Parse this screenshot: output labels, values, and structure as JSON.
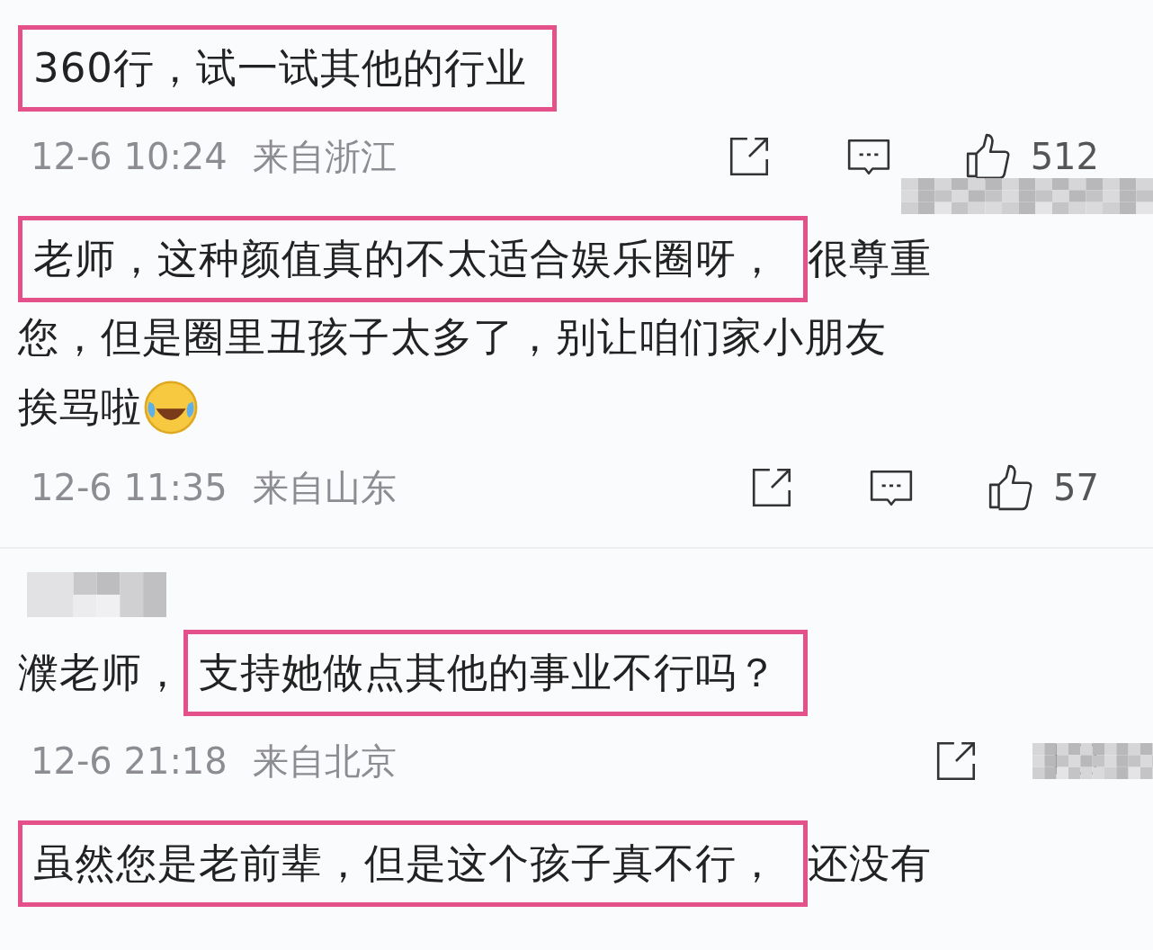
{
  "comments": [
    {
      "username_redacted": false,
      "segments": [
        {
          "kind": "text",
          "text": "360行，试一试其他的行业",
          "highlighted": true
        }
      ],
      "time": "12-6 10:24",
      "location": "来自浙江",
      "likes": "512",
      "actions_redacted": true
    },
    {
      "username_redacted": false,
      "segments": [
        {
          "kind": "text",
          "text": "老师，这种颜值真的不太适合娱乐圈呀，",
          "highlighted": true
        },
        {
          "kind": "text",
          "text": "很尊重",
          "highlighted": false
        },
        {
          "kind": "text",
          "text": "您，但是圈里丑孩子太多了，别让咱们家小朋友",
          "highlighted": false
        },
        {
          "kind": "text",
          "text": "挨骂啦",
          "highlighted": false
        },
        {
          "kind": "emoji"
        }
      ],
      "time": "12-6 11:35",
      "location": "来自山东",
      "likes": "57",
      "actions_redacted": false
    },
    {
      "username_redacted": true,
      "segments": [
        {
          "kind": "text",
          "text": "濮老师，",
          "highlighted": false
        },
        {
          "kind": "text",
          "text": "支持她做点其他的事业不行吗？",
          "highlighted": true
        }
      ],
      "time": "12-6 21:18",
      "location": "来自北京",
      "actions_redacted": true
    },
    {
      "username_redacted": false,
      "segments": [
        {
          "kind": "text",
          "text": "虽然您是老前辈，但是这个孩子真不行，",
          "highlighted": true
        },
        {
          "kind": "text",
          "text": "还没有",
          "highlighted": false
        }
      ]
    }
  ]
}
